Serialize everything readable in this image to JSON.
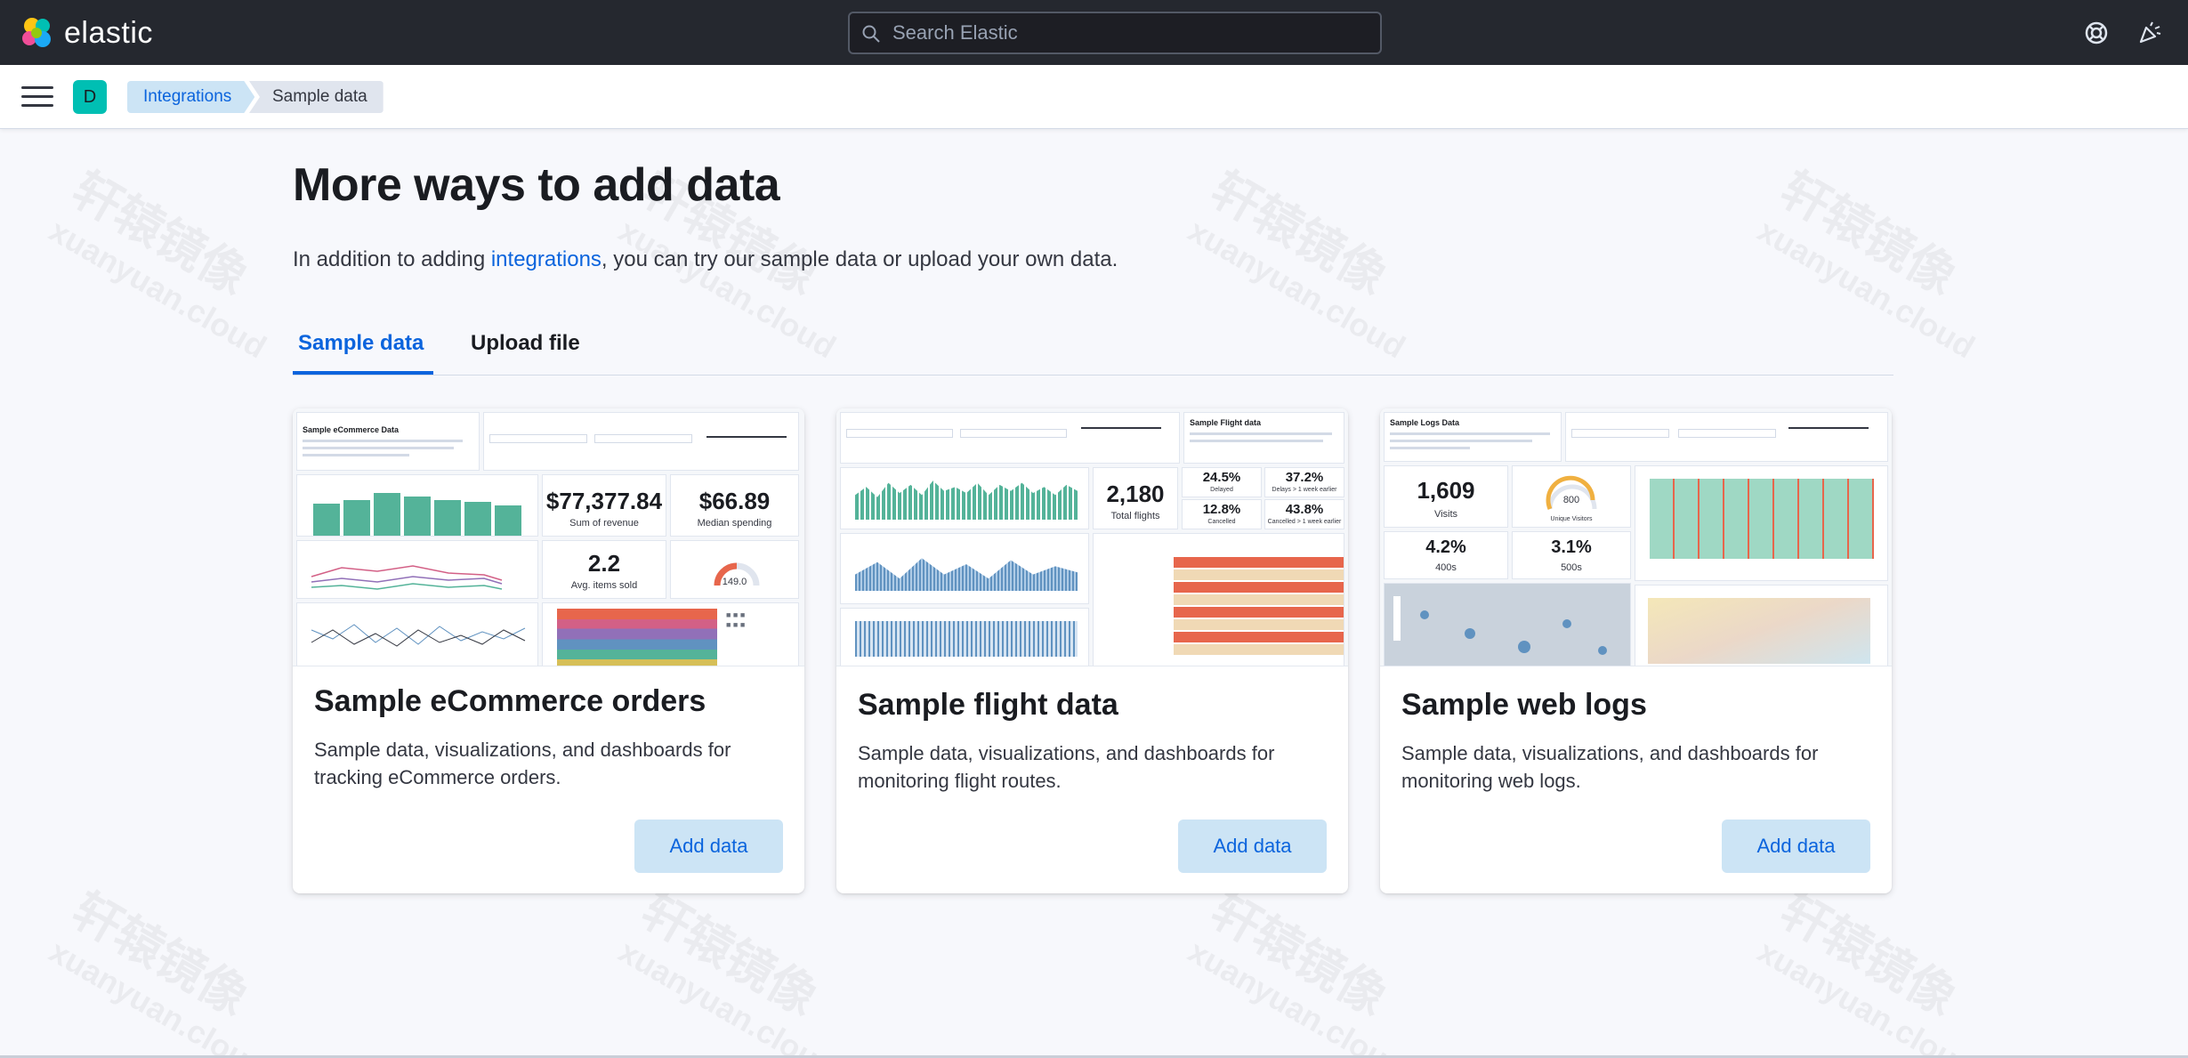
{
  "header": {
    "brand": "elastic",
    "search_placeholder": "Search Elastic"
  },
  "subbar": {
    "avatar_initial": "D",
    "breadcrumbs": [
      "Integrations",
      "Sample data"
    ]
  },
  "main": {
    "title": "More ways to add data",
    "intro_before": "In addition to adding ",
    "intro_link": "integrations",
    "intro_after": ", you can try our sample data or upload your own data.",
    "tabs": [
      {
        "label": "Sample data",
        "active": true
      },
      {
        "label": "Upload file",
        "active": false
      }
    ]
  },
  "cards": [
    {
      "title": "Sample eCommerce orders",
      "description": "Sample data, visualizations, and dashboards for tracking eCommerce orders.",
      "button": "Add data",
      "preview": {
        "heading": "Sample eCommerce Data",
        "metrics": [
          {
            "value": "$77,377.84",
            "label": "Sum of revenue"
          },
          {
            "value": "$66.89",
            "label": "Median spending"
          },
          {
            "value": "2.2",
            "label": "Avg. items sold"
          }
        ],
        "gauge_value": "149.0"
      }
    },
    {
      "title": "Sample flight data",
      "description": "Sample data, visualizations, and dashboards for monitoring flight routes.",
      "button": "Add data",
      "preview": {
        "heading": "Sample Flight data",
        "total": {
          "value": "2,180",
          "label": "Total flights"
        },
        "stats": [
          {
            "value": "24.5%",
            "label": "Delayed"
          },
          {
            "value": "37.2%",
            "label": "Delays > 1 week earlier"
          },
          {
            "value": "12.8%",
            "label": "Cancelled"
          },
          {
            "value": "43.8%",
            "label": "Cancelled > 1 week earlier"
          }
        ]
      }
    },
    {
      "title": "Sample web logs",
      "description": "Sample data, visualizations, and dashboards for monitoring web logs.",
      "button": "Add data",
      "preview": {
        "heading": "Sample Logs Data",
        "visits": {
          "value": "1,609",
          "label": "Visits"
        },
        "gauge_value": "800",
        "gauge_label": "Unique Visitors",
        "errors": [
          {
            "value": "4.2%",
            "label": "400s"
          },
          {
            "value": "3.1%",
            "label": "500s"
          }
        ]
      }
    }
  ],
  "colors": {
    "accent": "#0b64dd",
    "header_bg": "#25282f",
    "button_bg": "#cce4f5",
    "chart_green": "#54b399",
    "avatar": "#00bfb3"
  },
  "watermark": {
    "text": "轩辕镜像",
    "subtext": "xuanyuan.cloud"
  }
}
